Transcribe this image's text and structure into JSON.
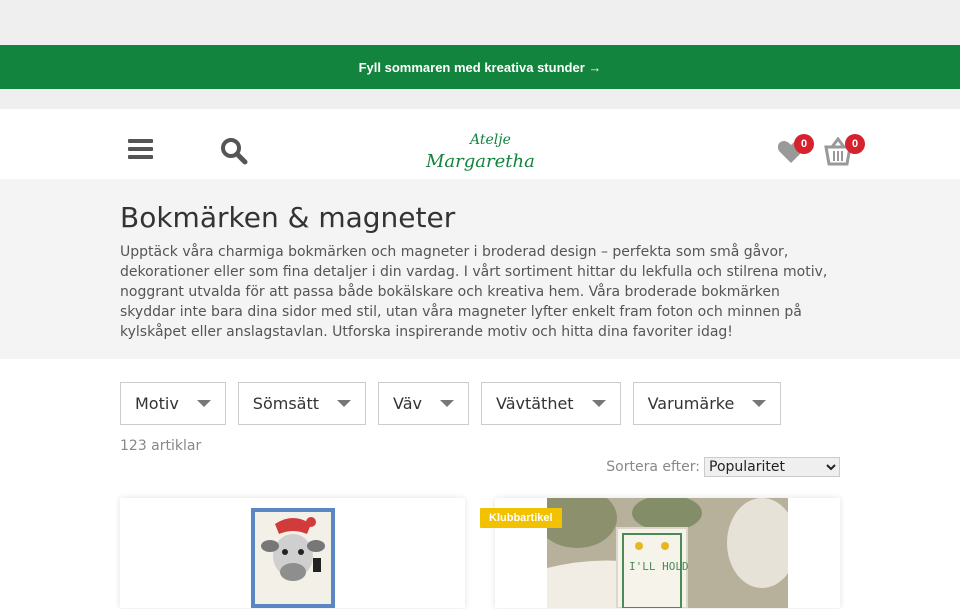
{
  "promo": {
    "text": "Fyll sommaren med kreativa stunder →"
  },
  "header": {
    "logo_line1": "Atelje",
    "logo_line2": "Margaretha",
    "wishlist_count": "0",
    "cart_count": "0"
  },
  "intro": {
    "title": "Bokmärken & magneter",
    "description": "Upptäck våra charmiga bokmärken och magneter i broderad design – perfekta som små gåvor, dekorationer eller som fina detaljer i din vardag. I vårt sortiment hittar du lekfulla och stilrena motiv, noggrant utvalda för att passa både bokälskare och kreativa hem. Våra broderade bokmärken skyddar inte bara dina sidor med stil, utan våra magneter lyfter enkelt fram foton och minnen på kylskåpet eller anslagstavlan. Utforska inspirerande motiv och hitta dina favoriter idag!"
  },
  "filters": [
    {
      "label": "Motiv"
    },
    {
      "label": "Sömsätt"
    },
    {
      "label": "Väv"
    },
    {
      "label": "Vävtäthet"
    },
    {
      "label": "Varumärke"
    }
  ],
  "listing": {
    "count": "123 artiklar",
    "sort_label": "Sortera efter:",
    "sort_value": "Popularitet"
  },
  "products": [
    {
      "badge": ""
    },
    {
      "badge": "Klubbartikel",
      "photo_text": "I'LL HOLD"
    }
  ],
  "colors": {
    "promo_bg": "#13843d",
    "badge_red": "#d6212f",
    "club_yellow": "#f2c200"
  }
}
